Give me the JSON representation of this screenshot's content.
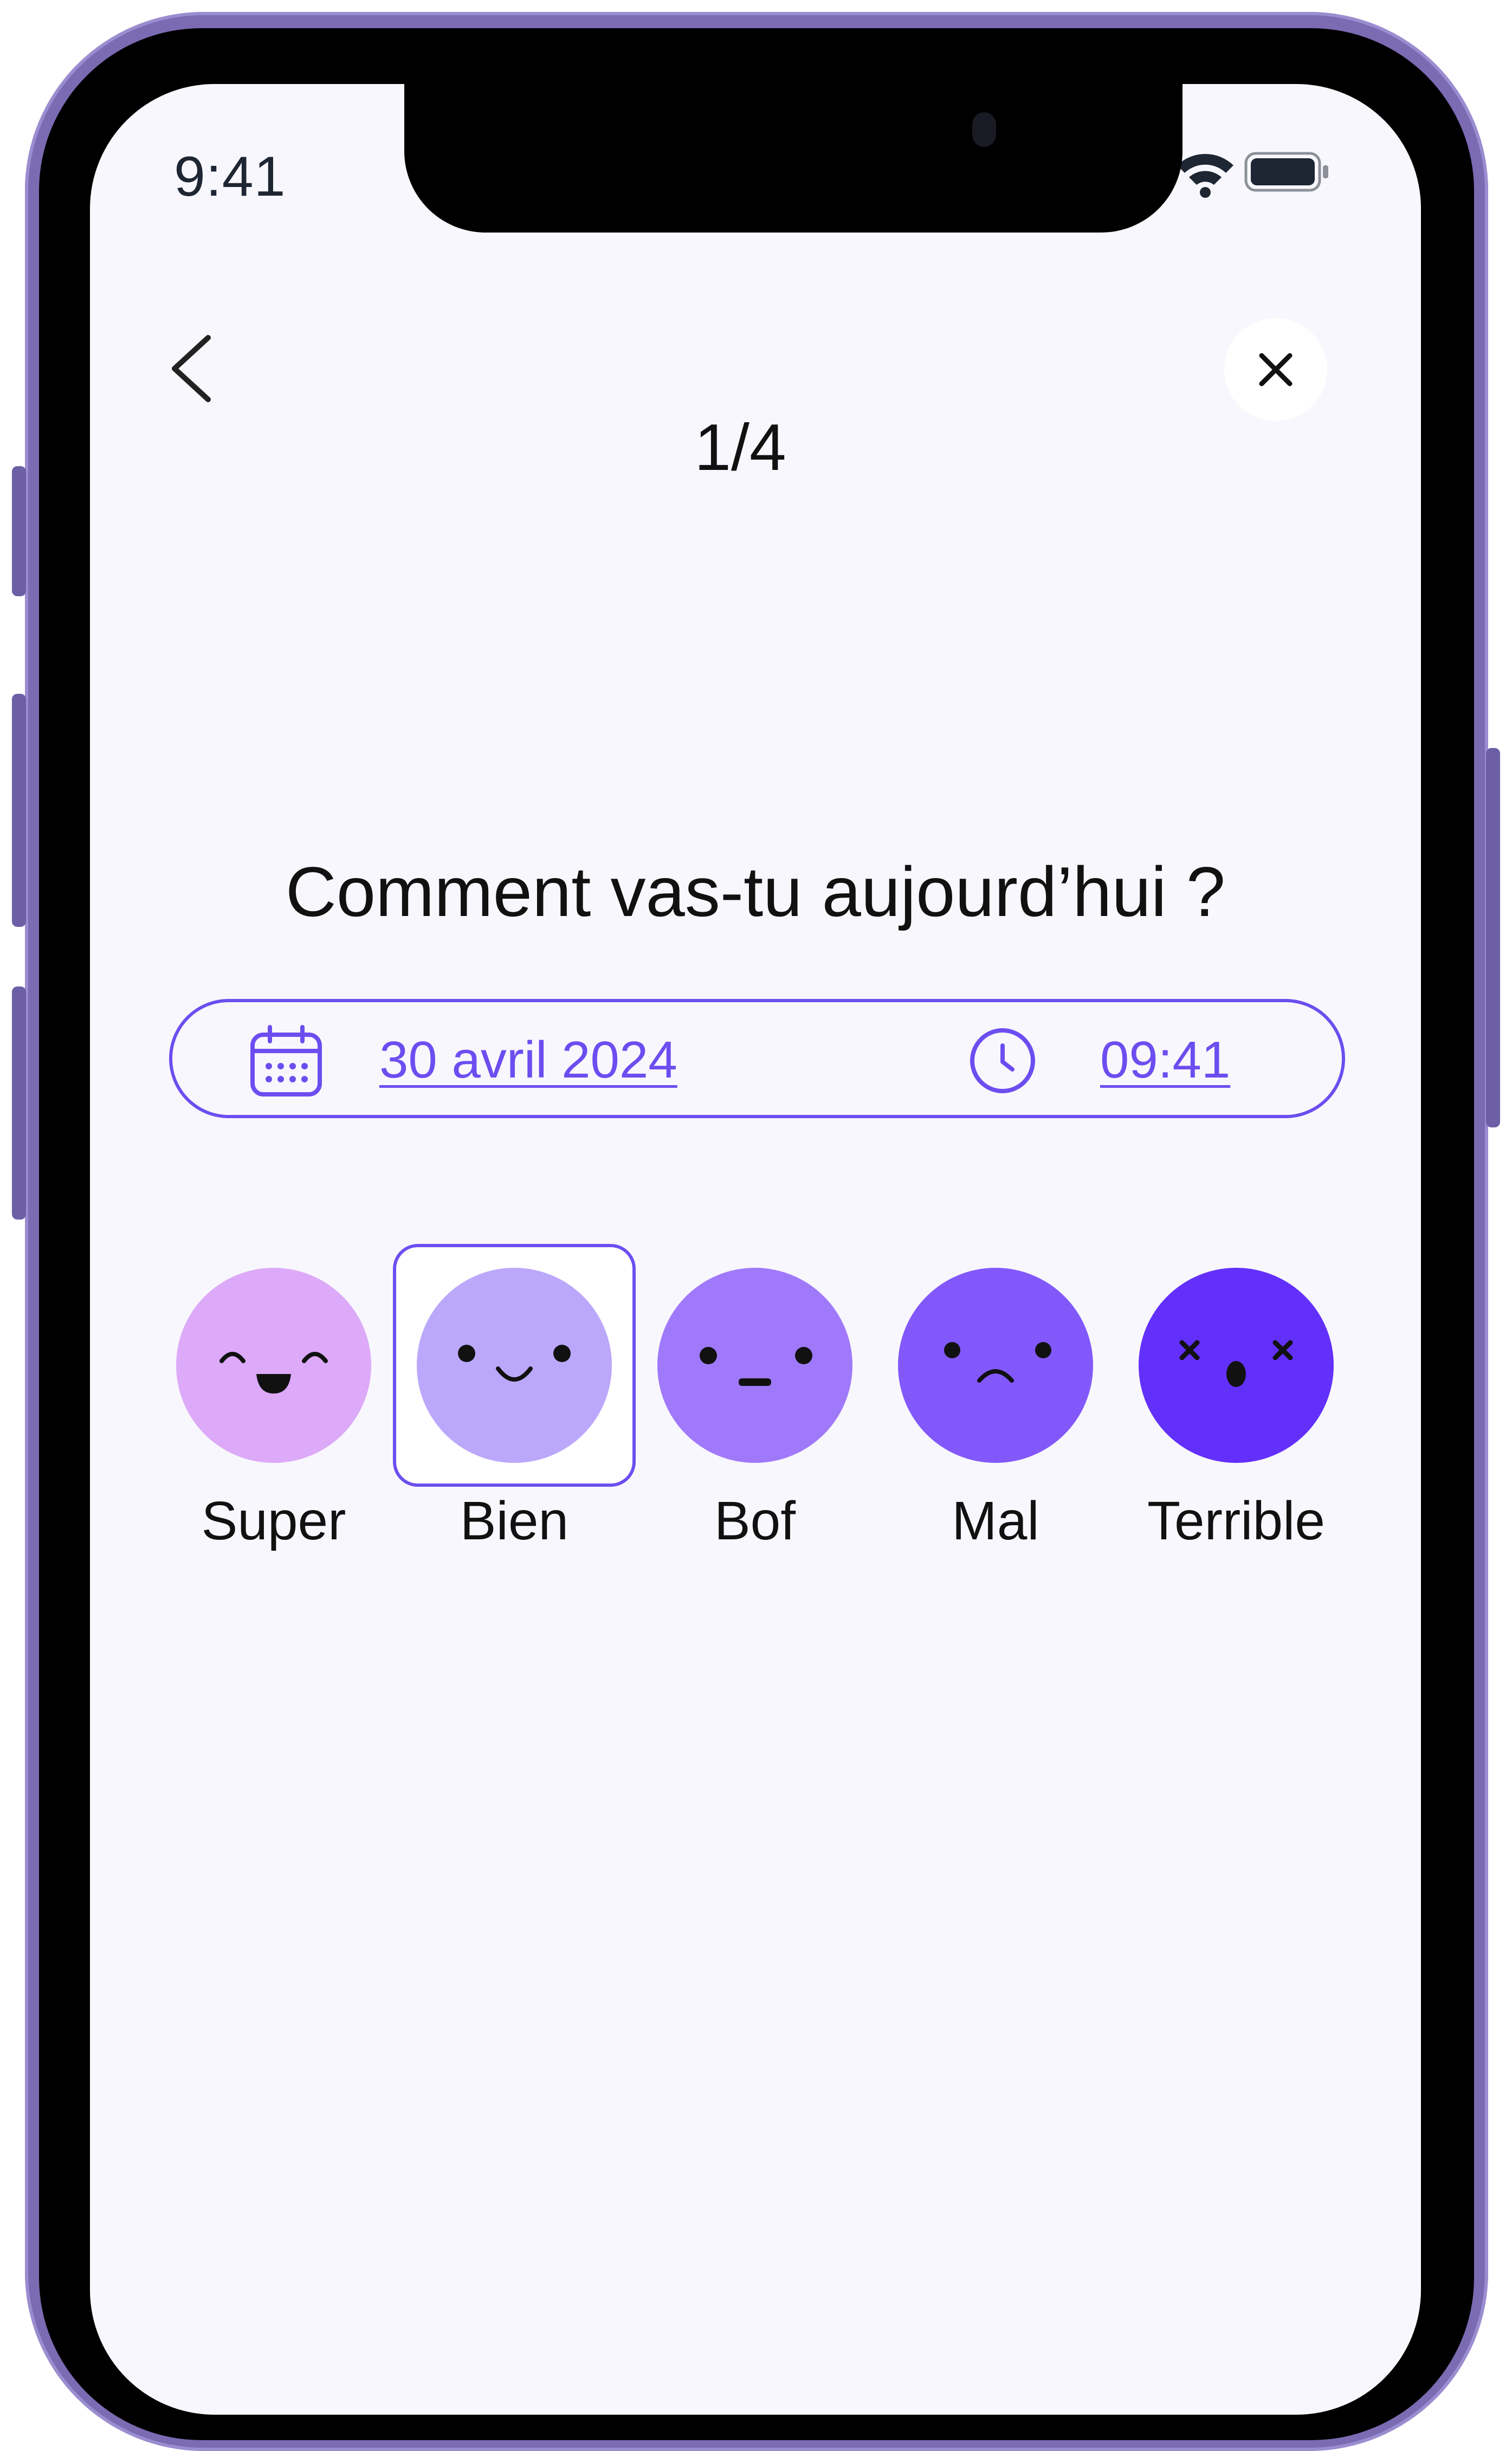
{
  "status_bar": {
    "time": "9:41"
  },
  "header": {
    "step_counter": "1/4"
  },
  "question": {
    "title": "Comment vas-tu aujourd’hui ?",
    "date": "30 avril 2024",
    "time": "09:41"
  },
  "moods": [
    {
      "label": "Super",
      "color": "#dcaaf8",
      "selected": false
    },
    {
      "label": "Bien",
      "color": "#bba8fb",
      "selected": true
    },
    {
      "label": "Bof",
      "color": "#a079fb",
      "selected": false
    },
    {
      "label": "Mal",
      "color": "#8258fb",
      "selected": false
    },
    {
      "label": "Terrible",
      "color": "#6330fb",
      "selected": false
    }
  ],
  "colors": {
    "accent": "#6c4ef0",
    "background": "#f8f7fd"
  }
}
